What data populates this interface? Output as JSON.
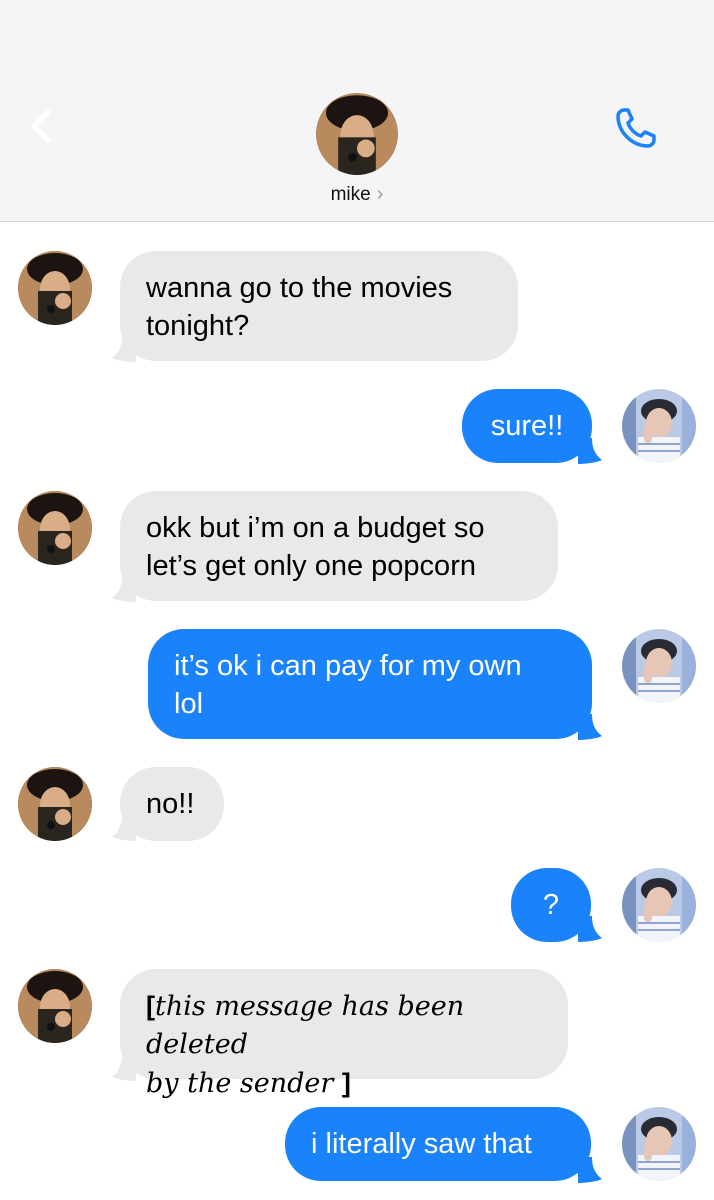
{
  "header": {
    "contact_name": "mike",
    "chevron": "›",
    "back_icon": "chevron-left-icon",
    "call_icon": "phone-icon"
  },
  "colors": {
    "outgoing": "#1a82fb",
    "incoming": "#e9e9eb",
    "accent": "#1a82fb"
  },
  "messages": [
    {
      "from": "mike",
      "text_line1": "wanna go to the movies",
      "text_line2": "tonight?"
    },
    {
      "from": "me",
      "text_line1": "sure!!"
    },
    {
      "from": "mike",
      "text_line1": "okk but i’m on a budget so",
      "text_line2": "let’s get only one popcorn"
    },
    {
      "from": "me",
      "text_line1": "it’s ok i can pay for my own",
      "text_line2": "lol"
    },
    {
      "from": "mike",
      "text_line1": "no!!"
    },
    {
      "from": "me",
      "text_line1": "?"
    },
    {
      "from": "mike",
      "open_bracket": "[",
      "text_line1": "this message has been deleted",
      "text_line2": "by the sender",
      "close_bracket": "]"
    },
    {
      "from": "me",
      "text_line1": "i literally saw that"
    }
  ]
}
